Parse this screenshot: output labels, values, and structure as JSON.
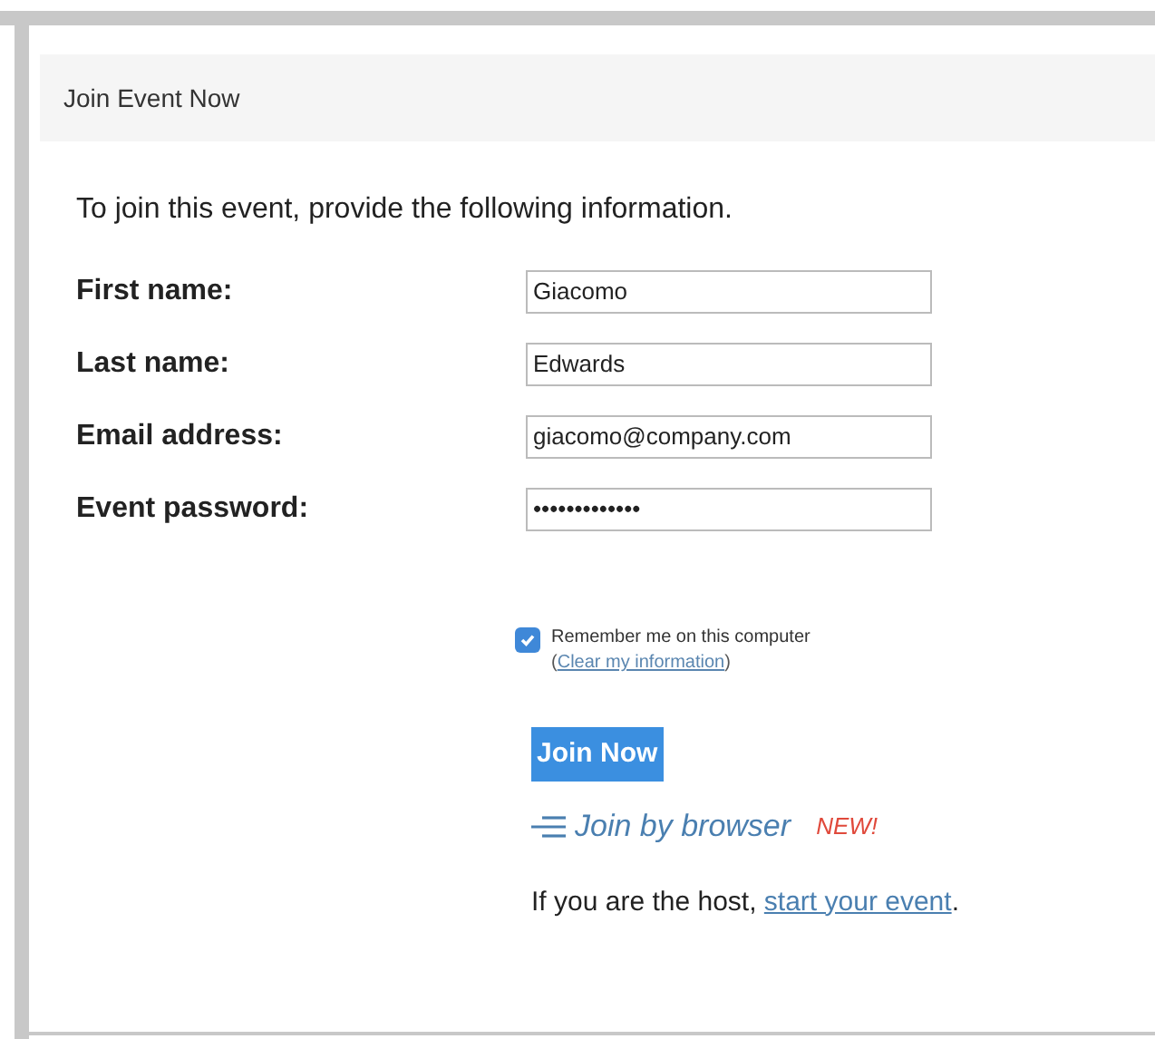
{
  "panel": {
    "title": "Join Event Now"
  },
  "intro": "To join this event, provide the following information.",
  "fields": [
    {
      "label": "First name:",
      "value": "Giacomo"
    },
    {
      "label": "Last name:",
      "value": "Edwards"
    },
    {
      "label": "Email address:",
      "value": "giacomo@company.com"
    },
    {
      "label": "Event password:",
      "value": "•••••••••••••"
    }
  ],
  "remember": {
    "label": "Remember me on this computer",
    "checked": true,
    "clear_prefix": "(",
    "clear_link": "Clear my information",
    "clear_suffix": ")"
  },
  "join_button": "Join Now",
  "browser_link": {
    "label": "Join by browser",
    "badge": "NEW!"
  },
  "host": {
    "text": "If you are the host, ",
    "link": "start your event",
    "suffix": "."
  }
}
